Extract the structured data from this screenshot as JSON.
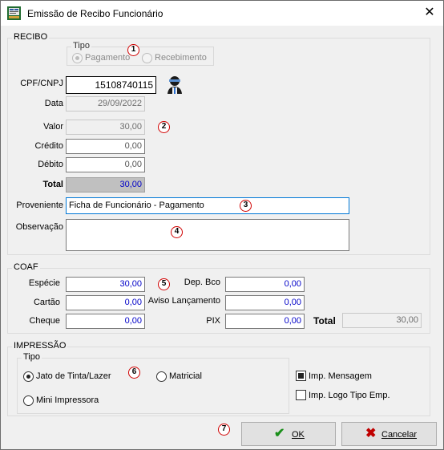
{
  "window": {
    "title": "Emissão de Recibo Funcionário",
    "close_glyph": "✕"
  },
  "recibo": {
    "legend": "RECIBO",
    "tipo": {
      "legend": "Tipo",
      "option1": "Pagamento",
      "option2": "Recebimento",
      "selected": "Pagamento"
    },
    "labels": {
      "cpf": "CPF/CNPJ",
      "data": "Data",
      "valor": "Valor",
      "credito": "Crédito",
      "debito": "Débito",
      "total": "Total",
      "proveniente": "Proveniente",
      "observacao": "Observação"
    },
    "values": {
      "cpf": "15108740115",
      "data": "29/09/2022",
      "valor": "30,00",
      "credito": "0,00",
      "debito": "0,00",
      "total": "30,00",
      "proveniente": "Ficha de Funcionário  - Pagamento",
      "observacao": ""
    }
  },
  "coaf": {
    "legend": "COAF",
    "labels": {
      "especie": "Espécie",
      "cartao": "Cartão",
      "cheque": "Cheque",
      "dep_bco": "Dep. Bco",
      "aviso": "Aviso Lançamento",
      "pix": "PIX",
      "total": "Total"
    },
    "values": {
      "especie": "30,00",
      "cartao": "0,00",
      "cheque": "0,00",
      "dep_bco": "0,00",
      "aviso": "0,00",
      "pix": "0,00",
      "total": "30,00"
    }
  },
  "impressao": {
    "legend": "IMPRESSÃO",
    "tipo_legend": "Tipo",
    "options": {
      "jato": "Jato de Tinta/Lazer",
      "matricial": "Matricial",
      "mini": "Mini Impressora"
    },
    "selected": "Jato de Tinta/Lazer",
    "checks": {
      "mensagem": "Imp. Mensagem",
      "logo": "Imp. Logo Tipo Emp."
    },
    "checked": {
      "mensagem": true,
      "logo": false
    }
  },
  "buttons": {
    "ok": "OK",
    "cancelar": "Cancelar"
  },
  "icons": {
    "app": "receipt-app-icon",
    "user_search": "user-search-icon",
    "ok": "checkmark-icon",
    "cancel": "red-x-icon"
  },
  "annotations": [
    "1",
    "2",
    "3",
    "4",
    "5",
    "6",
    "7"
  ],
  "colors": {
    "accent_blue": "#0000c8",
    "annotation_red": "#d00000",
    "ok_green": "#1a8f1a",
    "cancel_red": "#c00000"
  }
}
